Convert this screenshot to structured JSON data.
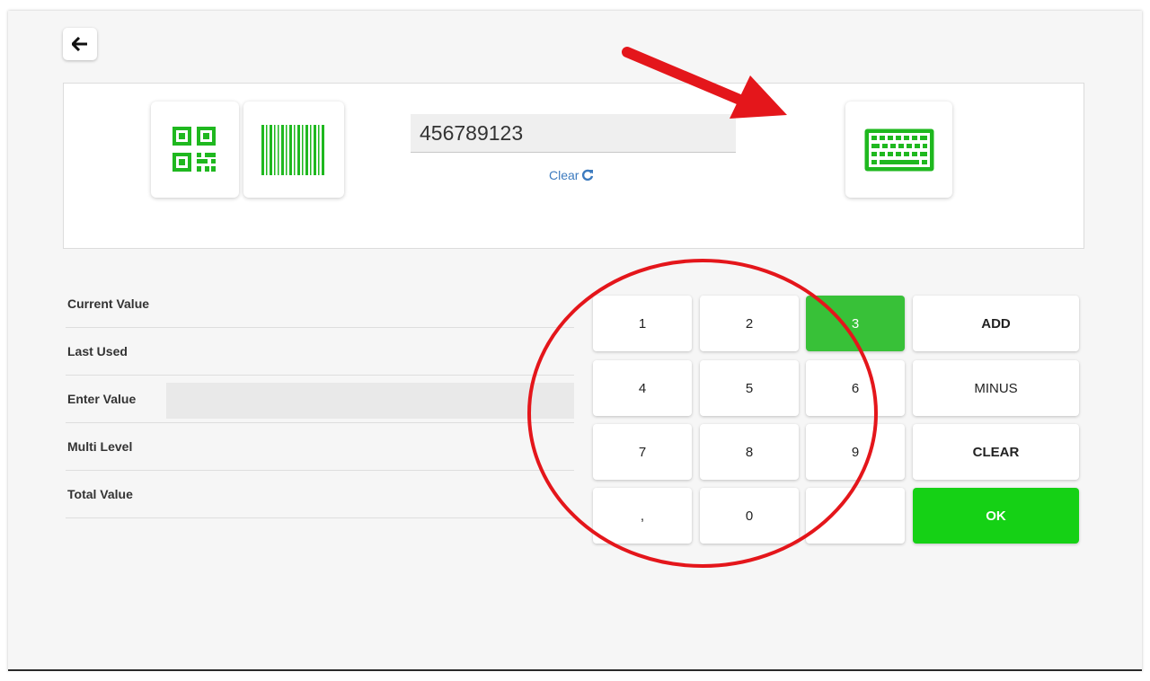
{
  "colors": {
    "brand_green": "#1fb81f",
    "active_key": "#38c138",
    "ok_button": "#15d115",
    "link_blue": "#3d7bbf",
    "annotation_red": "#e4161b"
  },
  "icons": {
    "back": "arrow-left-icon",
    "qr": "qr-code-icon",
    "barcode": "barcode-icon",
    "keyboard": "keyboard-icon",
    "refresh": "refresh-icon"
  },
  "scanner": {
    "value": "456789123",
    "clear_label": "Clear"
  },
  "form": {
    "current_value_label": "Current Value",
    "last_used_label": "Last Used",
    "enter_value_label": "Enter Value",
    "enter_value_value": "",
    "multi_level_label": "Multi Level",
    "total_value_label": "Total Value"
  },
  "keypad": {
    "k1": "1",
    "k2": "2",
    "k3": "3",
    "k4": "4",
    "k5": "5",
    "k6": "6",
    "k7": "7",
    "k8": "8",
    "k9": "9",
    "comma": ",",
    "k0": "0",
    "blank": "",
    "add": "ADD",
    "minus": "MINUS",
    "clear": "CLEAR",
    "ok": "OK"
  }
}
